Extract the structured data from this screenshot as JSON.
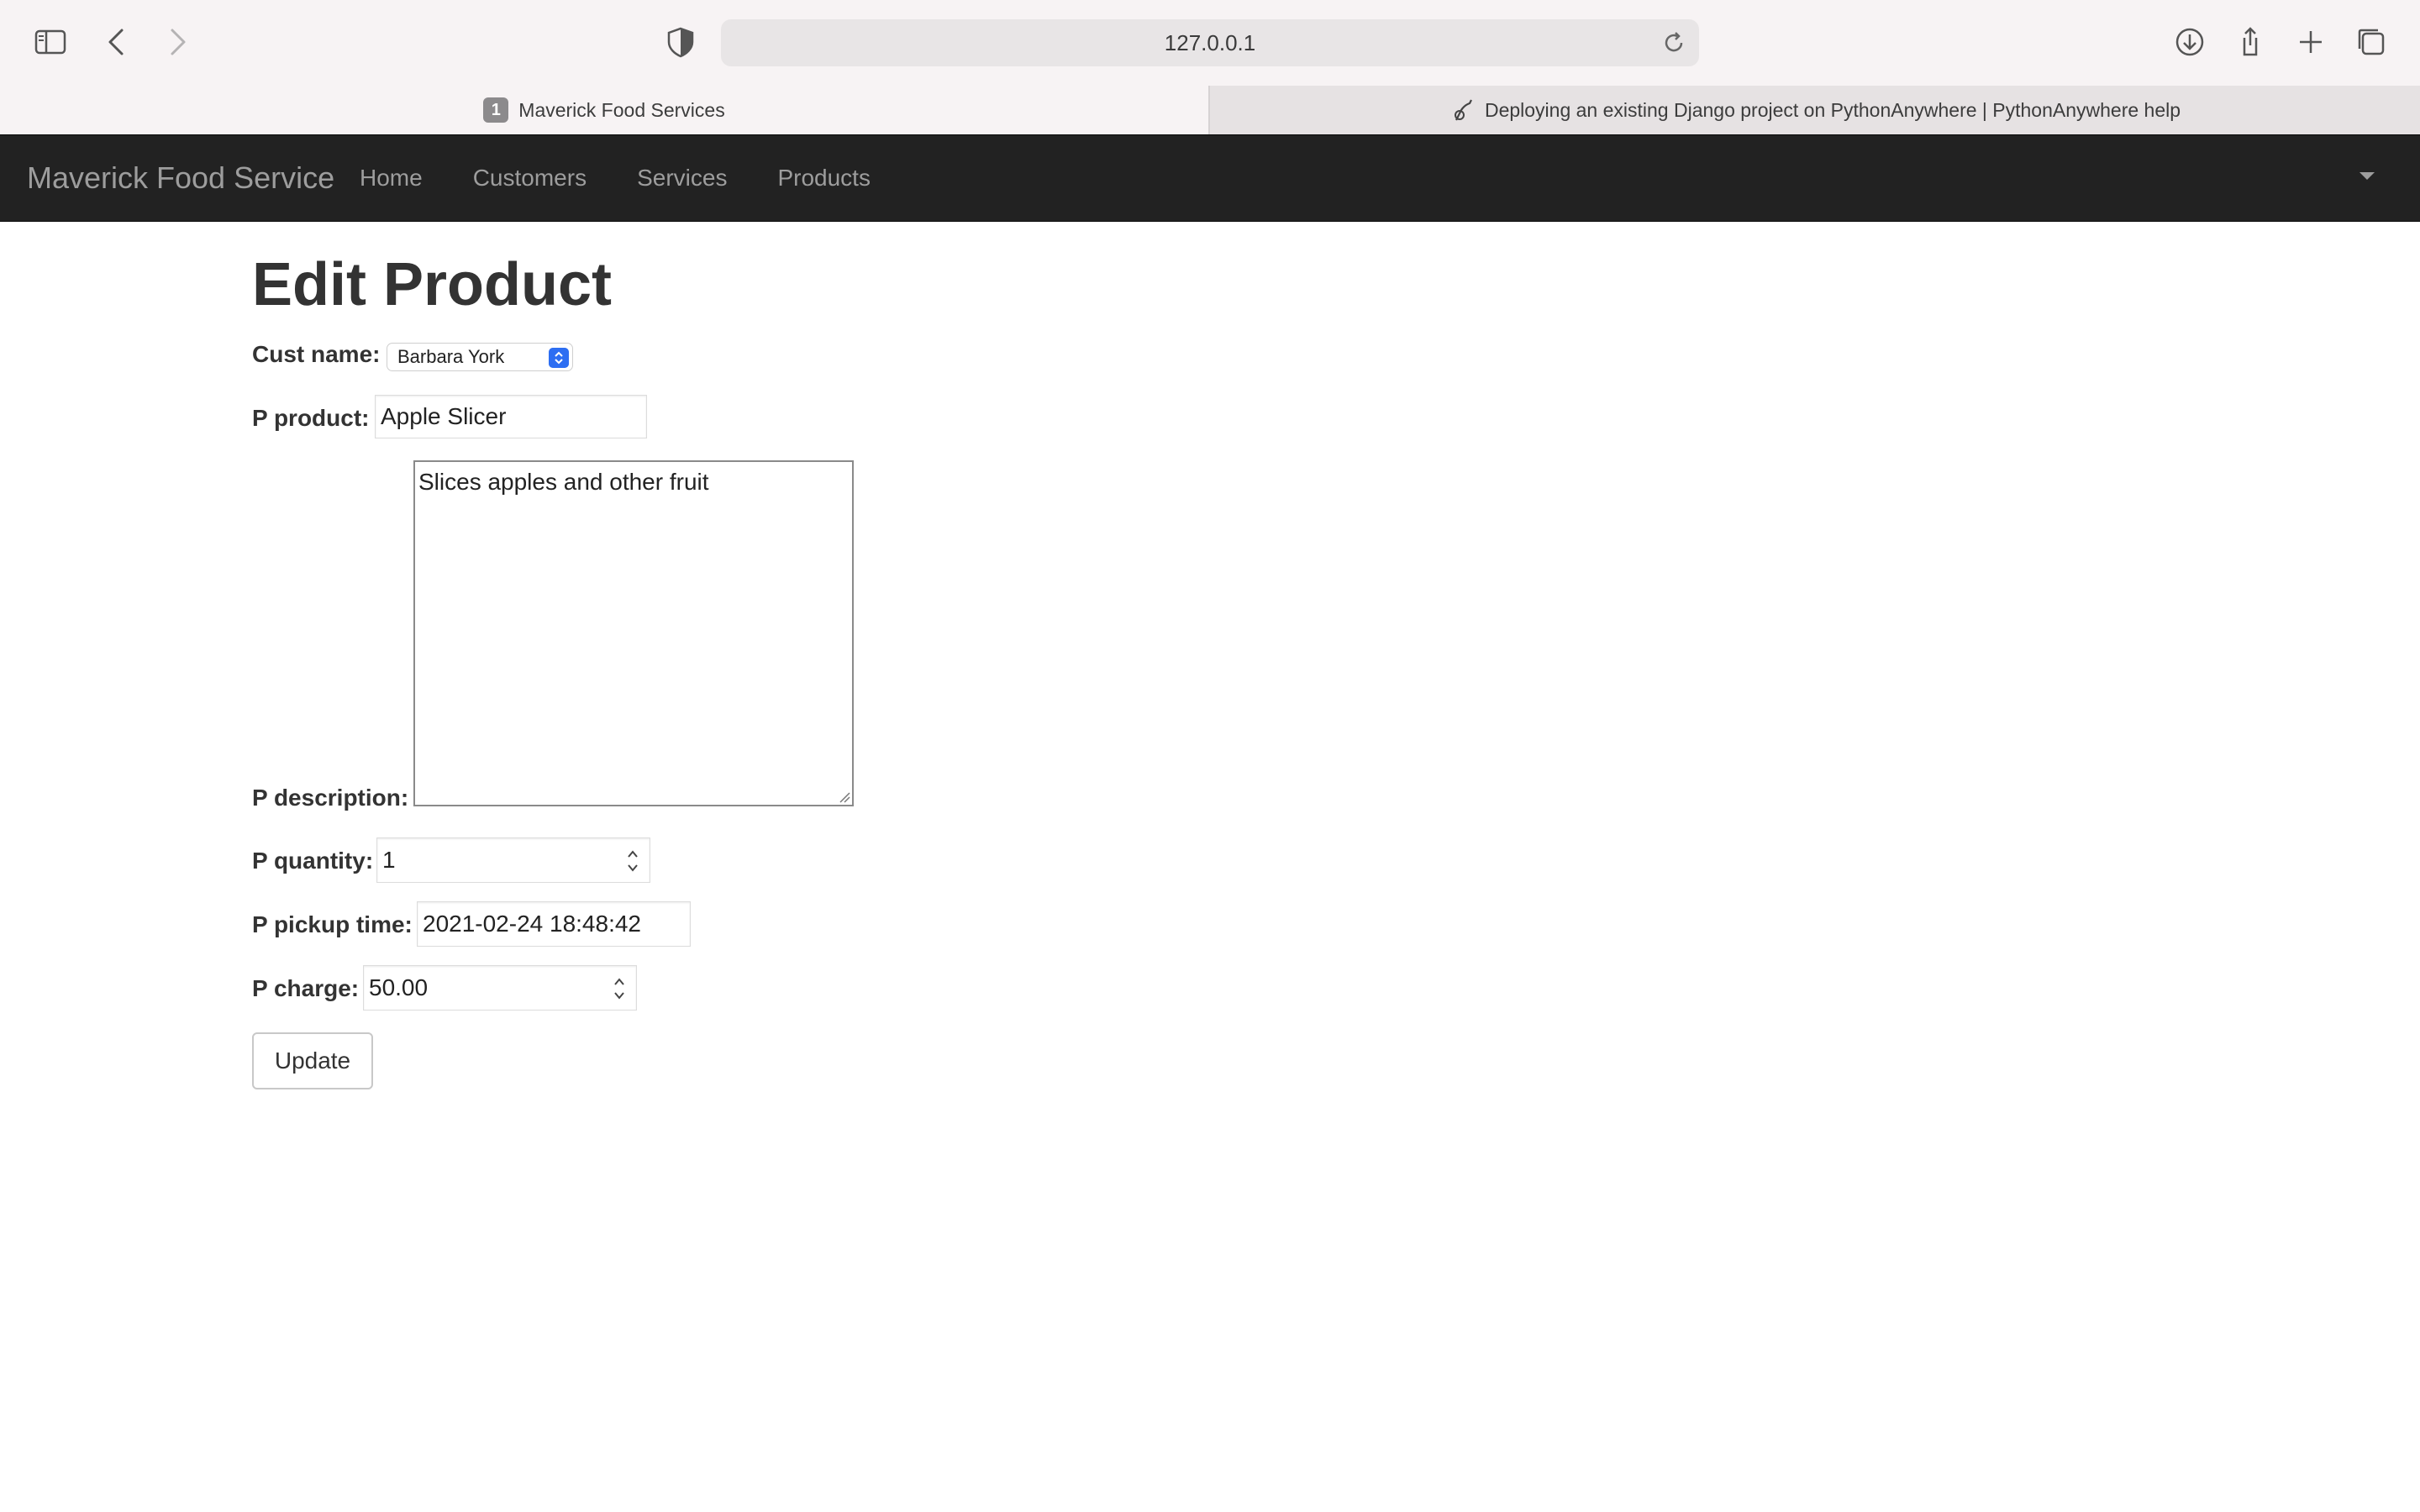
{
  "browser": {
    "url": "127.0.0.1",
    "tabs": [
      {
        "badge": "1",
        "title": "Maverick Food Services",
        "active": true
      },
      {
        "title": "Deploying an existing Django project on PythonAnywhere | PythonAnywhere help",
        "active": false
      }
    ],
    "icons": [
      "sidebar-icon",
      "back-icon",
      "forward-icon",
      "privacy-shield-icon",
      "reload-icon",
      "download-icon",
      "share-icon",
      "new-tab-icon",
      "tab-overview-icon"
    ]
  },
  "navbar": {
    "brand": "Maverick Food Service",
    "links": [
      "Home",
      "Customers",
      "Services",
      "Products"
    ],
    "background": "#222222",
    "link_color": "#9d9d9d"
  },
  "page": {
    "title": "Edit Product",
    "form": {
      "cust_name": {
        "label": "Cust name:",
        "value": "Barbara York"
      },
      "p_product": {
        "label": "P product:",
        "value": "Apple Slicer"
      },
      "p_description": {
        "label": "P description:",
        "value": "Slices apples and other fruit"
      },
      "p_quantity": {
        "label": "P quantity:",
        "value": "1"
      },
      "p_pickup_time": {
        "label": "P pickup time:",
        "value": "2021-02-24 18:48:42"
      },
      "p_charge": {
        "label": "P charge:",
        "value": "50.00"
      },
      "submit": "Update"
    }
  },
  "colors": {
    "select_accent": "#2d6ef2",
    "chrome_bg": "#f7f3f4"
  }
}
